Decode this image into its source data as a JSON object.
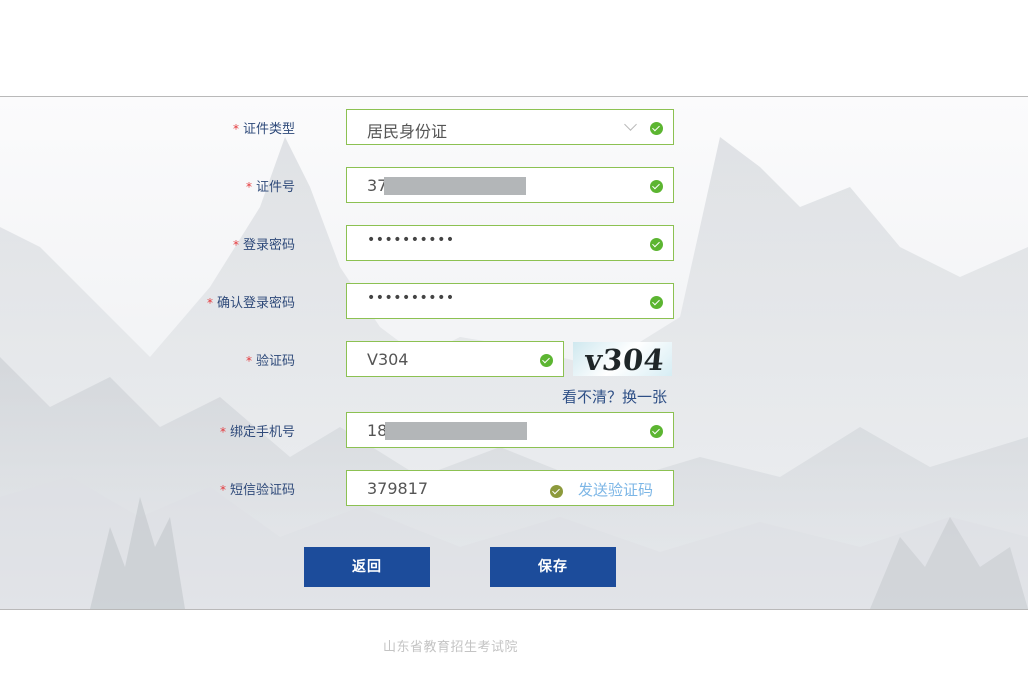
{
  "form": {
    "id_type": {
      "label": "证件类型",
      "required_mark": "*",
      "value": "居民身份证"
    },
    "id_number": {
      "label": "证件号",
      "required_mark": "*",
      "value_prefix": "37"
    },
    "login_password": {
      "label": "登录密码",
      "required_mark": "*",
      "value": "••••••••••"
    },
    "confirm_password": {
      "label": "确认登录密码",
      "required_mark": "*",
      "value": "••••••••••"
    },
    "captcha": {
      "label": "验证码",
      "required_mark": "*",
      "value": "V304",
      "image_text": "v304",
      "refresh_link": "看不清？换一张"
    },
    "phone": {
      "label": "绑定手机号",
      "required_mark": "*",
      "value_prefix": "18"
    },
    "sms_code": {
      "label": "短信验证码",
      "required_mark": "*",
      "value": "379817",
      "send_link": "发送验证码"
    }
  },
  "buttons": {
    "back": "返回",
    "save": "保存"
  },
  "footer": {
    "text": "山东省教育招生考试院"
  },
  "colors": {
    "accent": "#1c4c9b",
    "valid_border": "#8cc152",
    "valid_icon": "#5cb531",
    "required": "#e4393c",
    "label": "#2f4a7a",
    "link": "#2e4f86",
    "link_light": "#7cb6e6"
  },
  "icons": [
    "check-circle-icon",
    "chevron-down-icon"
  ]
}
